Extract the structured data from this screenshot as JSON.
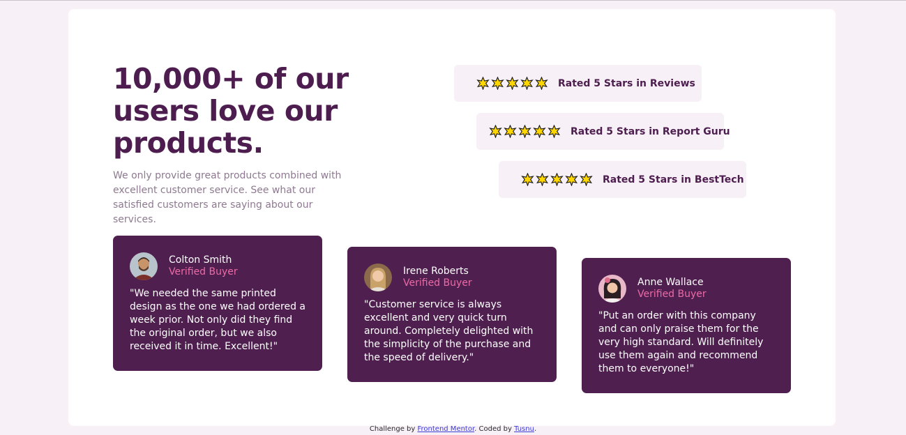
{
  "hero": {
    "title": "10,000+ of our users love our products.",
    "description": "We only provide great products combined with excellent customer service. See what our satisfied customers are saying about our services."
  },
  "ratings": [
    {
      "stars": 5,
      "label": "Rated 5 Stars in Reviews"
    },
    {
      "stars": 5,
      "label": "Rated 5 Stars in Report Guru"
    },
    {
      "stars": 5,
      "label": "Rated 5 Stars in BestTech"
    }
  ],
  "testimonials": [
    {
      "name": "Colton Smith",
      "role": "Verified Buyer",
      "quote": "\"We needed the same printed design as the one we had ordered a week prior. Not only did they find the original order, but we also received it in time. Excellent!\""
    },
    {
      "name": "Irene Roberts",
      "role": "Verified Buyer",
      "quote": "\"Customer service is always excellent and very quick turn around. Completely delighted with the simplicity of the purchase and the speed of delivery.\""
    },
    {
      "name": "Anne Wallace",
      "role": "Verified Buyer",
      "quote": "\"Put an order with this company and can only praise them for the very high standard. Will definitely use them again and recommend them to everyone!\""
    }
  ],
  "footer": {
    "prefix": "Challenge by ",
    "link1": "Frontend Mentor",
    "middle": ". Coded by ",
    "link2": "Tusnu",
    "suffix": "."
  },
  "colors": {
    "background": "#f7f0f7",
    "primary": "#4e1d4f",
    "accent": "#ee6aa6",
    "muted": "#8e7990",
    "star": "#ffd600"
  },
  "icons": {
    "rating_star": "star-icon"
  }
}
